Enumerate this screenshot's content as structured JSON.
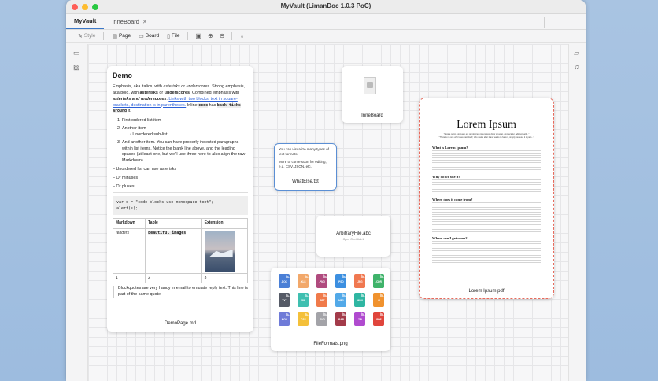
{
  "window": {
    "title": "MyVault (LimanDoc 1.0.3 PoC)"
  },
  "tabs": [
    {
      "label": "MyVault"
    },
    {
      "label": "InneBoard",
      "close": "✕"
    }
  ],
  "toolbar": {
    "style": "Style",
    "page": "Page",
    "board": "Board",
    "file": "File"
  },
  "colors": {
    "accent": "#3b78c8",
    "selected_dash": "#e76a5c",
    "link": "#2a5fd8"
  },
  "demo": {
    "heading": "Demo",
    "para1_a": "Emphasis, aka italics, with ",
    "para1_b": "asterisks",
    "para1_c": " or ",
    "para1_d": "underscores",
    "para1_e": ". Strong emphasis, aka bold, with ",
    "para1_f": "asterisks",
    "para1_g": " or ",
    "para1_h": "underscores",
    "para1_i": ". Combined emphasis with ",
    "para1_j": "asterisks and underscores",
    "para1_k": ". ",
    "para1_link": "Links with two blocks, text in square-brackets, destination is in parentheses.",
    "para1_l": " Inline ",
    "para1_code1": "code",
    "para1_m": " has ",
    "para1_code2": "back-ticks around",
    "para1_n": " it.",
    "ol1": "First ordered list item",
    "ol2": "Another item",
    "ol2_sub": "◦ Unordered sub-list.",
    "ol3": "And another item. You can have properly indented paragraphs within list items. Notice the blank line above, and the leading spaces (at least one, but we'll use three here to also align the raw Markdown).",
    "ul1": "– Unordered list can use asterisks",
    "ul2": "– Or minuses",
    "ul3": "– Or pluses",
    "code_line1": "var s = \"code blocks use monospace font\";",
    "code_line2": "alert(s);",
    "table": {
      "headers": [
        "Markdown",
        "Table",
        "Extension"
      ],
      "row1_c1": "renders",
      "row1_c2": "beautiful images",
      "row2": [
        "1",
        "2",
        "3"
      ]
    },
    "quote": "Blockquotes are very handy in email to emulate reply text. This line is part of the same quote.",
    "title": "DemoPage.md"
  },
  "inneboard": {
    "title": "InneBoard"
  },
  "whatelse": {
    "text1": "You can visualize many types of text formats.",
    "text2": "More to come soon for editing, e.g. CSV, JSON, etc.",
    "title": "WhatElse.txt"
  },
  "arbitrary": {
    "name": "ArbitraryFile.abc",
    "sub": "Open Om-Click it"
  },
  "fileformats": {
    "title": "FileFormats.png",
    "icons": [
      {
        "label": ".DOC",
        "color": "#4a7fd6"
      },
      {
        "label": ".XLS",
        "color": "#f2a86a"
      },
      {
        "label": ".PNG",
        "color": "#b04b7e"
      },
      {
        "label": ".PSD",
        "color": "#3c8fe0"
      },
      {
        "label": ".JPG",
        "color": "#f07850"
      },
      {
        "label": ".CDR",
        "color": "#3fb36a"
      },
      {
        "label": ".TXT",
        "color": "#555a66"
      },
      {
        "label": ".GIF",
        "color": "#3fbfb0"
      },
      {
        "label": ".PPT",
        "color": "#f07a4a"
      },
      {
        "label": ".MP3",
        "color": "#52a9e8"
      },
      {
        "label": ".WAV",
        "color": "#2fb6a2"
      },
      {
        "label": ".AI",
        "color": "#f0922e"
      },
      {
        "label": ".MOV",
        "color": "#6f7bd8"
      },
      {
        "label": ".CSS",
        "color": "#f4c03a"
      },
      {
        "label": ".SVG",
        "color": "#a3a3a8"
      },
      {
        "label": ".RAR",
        "color": "#a33b4a"
      },
      {
        "label": ".ZIP",
        "color": "#b04bcf"
      },
      {
        "label": ".PDF",
        "color": "#e0453c"
      }
    ]
  },
  "pdf": {
    "heading": "Lorem Ipsum",
    "sub1": "\"Neque porro quisquam est qui dolorem ipsum quia dolor sit amet, consectetur, adipisci velit...\"",
    "sub2": "\"There is no one who loves pain itself, who seeks after it and wants to have it, simply because it is pain...\"",
    "h1": "What is Lorem Ipsum?",
    "h2": "Why do we use it?",
    "h3": "Where does it come from?",
    "h4": "Where can I get some?",
    "title": "Lorem Ipsum.pdf"
  }
}
